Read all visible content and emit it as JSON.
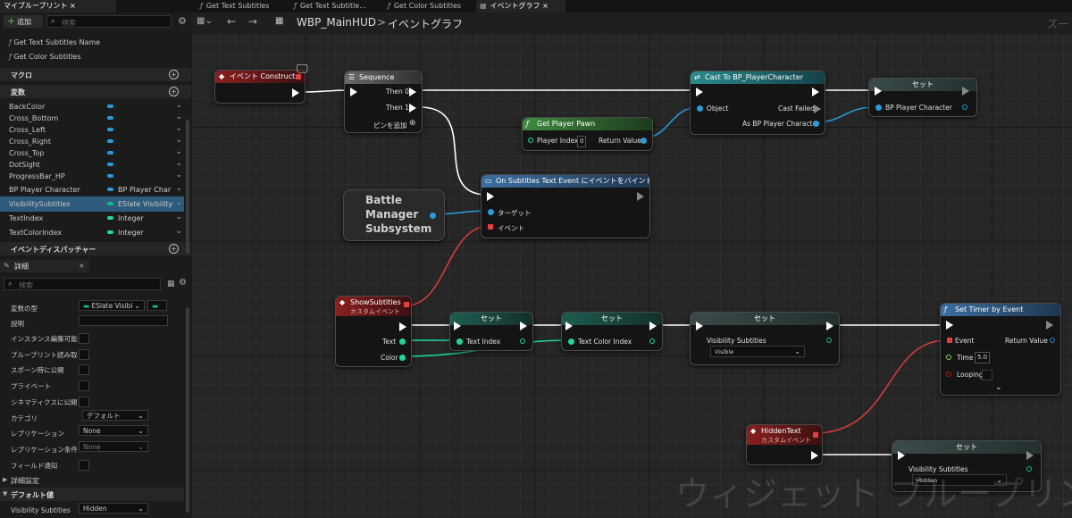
{
  "tabs": [
    {
      "label": "マイブループリント ×"
    },
    {
      "label": "Get Text Subtitles"
    },
    {
      "label": "Get Text Subtitle..."
    },
    {
      "label": "Get Color Subtitles"
    },
    {
      "label": "イベントグラフ ×"
    }
  ],
  "toolbar": {
    "add_label": "追加",
    "search_placeholder": "検索"
  },
  "functions": [
    "Get Text Subtitles Name",
    "Get Color Subtitles"
  ],
  "sections": {
    "macro": "マクロ",
    "variables": "変数",
    "dispatchers": "イベントディスパッチャー",
    "details": "詳細",
    "advanced": "詳細設定",
    "default_value": "デフォルト値"
  },
  "variables": [
    {
      "name": "BackColor",
      "type": ""
    },
    {
      "name": "Cross_Bottom",
      "type": ""
    },
    {
      "name": "Cross_Left",
      "type": ""
    },
    {
      "name": "Cross_Right",
      "type": ""
    },
    {
      "name": "Cross_Top",
      "type": ""
    },
    {
      "name": "DotSight",
      "type": ""
    },
    {
      "name": "ProgressBar_HP",
      "type": ""
    },
    {
      "name": "BP Player Character",
      "type": "BP Player Char"
    },
    {
      "name": "VisibilitySubtitles",
      "type": "ESlate Visibility"
    },
    {
      "name": "TextIndex",
      "type": "Integer"
    },
    {
      "name": "TextColorIndex",
      "type": "Integer"
    }
  ],
  "variable_colors": [
    "#2a9ad8",
    "#2a9ad8",
    "#2a9ad8",
    "#2a9ad8",
    "#2a9ad8",
    "#2a9ad8",
    "#2a9ad8",
    "#2a9ad8",
    "#15b58b",
    "#1fd6a0",
    "#1fd6a0"
  ],
  "details": {
    "search_placeholder": "検索",
    "rows": [
      {
        "label": "変数の型",
        "value": "ESlate Visibi"
      },
      {
        "label": "説明",
        "value": ""
      },
      {
        "label": "インスタンス編集可能",
        "value": ""
      },
      {
        "label": "ブループリント読み取",
        "value": ""
      },
      {
        "label": "スポーン時に公開",
        "value": ""
      },
      {
        "label": "プライベート",
        "value": ""
      },
      {
        "label": "シネマティクスに公開",
        "value": ""
      },
      {
        "label": "カテゴリ",
        "value": "デフォルト"
      },
      {
        "label": "レプリケーション",
        "value": "None"
      },
      {
        "label": "レプリケーション条件",
        "value": "None"
      },
      {
        "label": "フィールド通知",
        "value": ""
      }
    ],
    "default_row": {
      "label": "Visibility Subtitles",
      "value": "Hidden"
    }
  },
  "breadcrumb": {
    "asset": "WBP_MainHUD",
    "separator": ">",
    "graph": "イベントグラフ",
    "zoom": "ズー"
  },
  "nodes": {
    "construct": {
      "title": "イベント Construct"
    },
    "sequence": {
      "title": "Sequence",
      "then0": "Then 0",
      "then1": "Then 1",
      "add_pin": "ピンを追加"
    },
    "cast": {
      "title": "Cast To BP_PlayerCharacter",
      "object": "Object",
      "failed": "Cast Failed",
      "as": "As BP Player Character"
    },
    "set1": {
      "title": "セット",
      "pin": "BP Player Character"
    },
    "get_pawn": {
      "title": "Get Player Pawn",
      "index_label": "Player Index",
      "index_value": "0",
      "ret": "Return Value"
    },
    "bind": {
      "title": "On Subtitles Text Event にイベントをバインド",
      "target": "ターゲット",
      "event": "イベント"
    },
    "battle": {
      "title": "Battle Manager Subsystem"
    },
    "show": {
      "title": "ShowSubtitles",
      "sub": "カスタムイベント",
      "text": "Text",
      "color": "Color"
    },
    "set_text": {
      "title": "セット",
      "pin": "Text Index"
    },
    "set_color": {
      "title": "セット",
      "pin": "Text Color Index"
    },
    "set_vis": {
      "title": "セット",
      "pin": "Visibility Subtitles",
      "value": "Visible"
    },
    "timer": {
      "title": "Set Timer by Event",
      "event": "Event",
      "ret": "Return Value",
      "time": "Time",
      "time_value": "5.0",
      "looping": "Looping"
    },
    "hidden": {
      "title": "HiddenText",
      "sub": "カスタムイベント"
    },
    "set_hidden": {
      "title": "セット",
      "pin": "Visibility Subtitles",
      "value": "Hidden"
    }
  },
  "watermark": "ウィジェット ブループリン"
}
